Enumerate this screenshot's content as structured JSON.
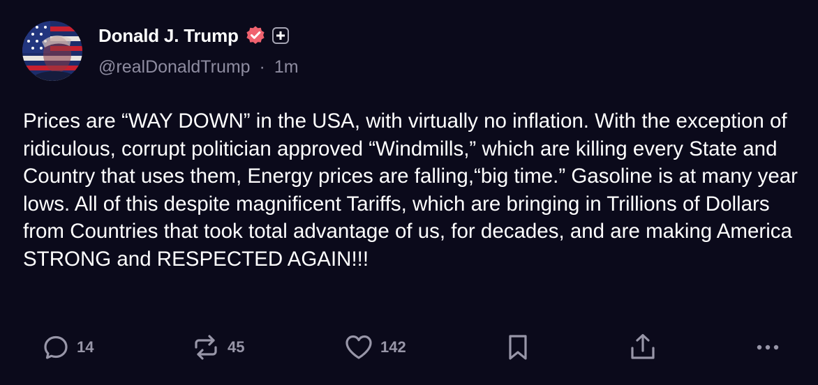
{
  "author": {
    "display_name": "Donald J. Trump",
    "handle": "@realDonaldTrump",
    "time_separator": "·",
    "timestamp": "1m",
    "verified": true,
    "verified_color": "#f0626f"
  },
  "post": {
    "text": "Prices are “WAY DOWN” in the USA, with virtually no inflation. With the exception of ridiculous, corrupt politician approved “Windmills,” which are killing every State and Country that uses them, Energy prices are falling,“big time.” Gasoline is at many year lows. All of this despite magnificent Tariffs, which are bringing in Trillions of Dollars from Countries that took total advantage of us, for decades, and are making America STRONG and RESPECTED AGAIN!!!"
  },
  "actions": {
    "reply": {
      "icon": "reply-icon",
      "count": "14"
    },
    "retruth": {
      "icon": "repost-icon",
      "count": "45"
    },
    "like": {
      "icon": "heart-icon",
      "count": "142"
    },
    "bookmark": {
      "icon": "bookmark-icon"
    },
    "share": {
      "icon": "share-icon"
    },
    "more": {
      "icon": "more-icon"
    }
  },
  "colors": {
    "background": "#0b0a1b",
    "primary_text": "#ffffff",
    "secondary_text": "#8e8ca0",
    "icon": "#9896a8"
  }
}
